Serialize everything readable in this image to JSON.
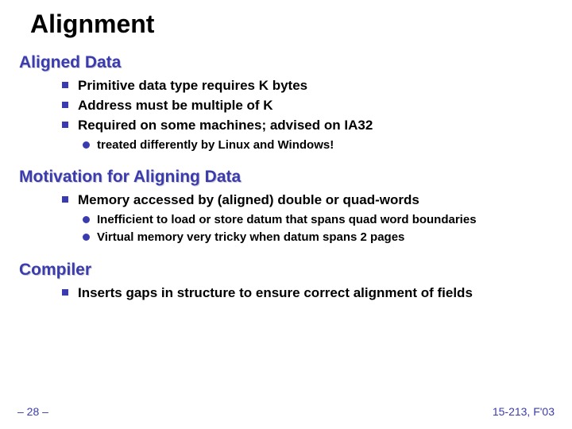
{
  "title": "Alignment",
  "sections": [
    {
      "heading": "Aligned Data",
      "items": [
        {
          "text": "Primitive data type requires K bytes"
        },
        {
          "text": "Address must be multiple of K"
        },
        {
          "text": "Required on some machines; advised on IA32",
          "subitems": [
            "treated differently by Linux and Windows!"
          ]
        }
      ]
    },
    {
      "heading": "Motivation for Aligning Data",
      "items": [
        {
          "text": "Memory accessed by (aligned) double or quad-words",
          "subitems": [
            "Inefficient to load or store datum that spans quad word boundaries",
            "Virtual memory very tricky when datum spans 2 pages"
          ]
        }
      ]
    },
    {
      "heading": "Compiler",
      "items": [
        {
          "text": "Inserts gaps in structure to ensure correct alignment of fields"
        }
      ]
    }
  ],
  "footer": {
    "page": "– 28 –",
    "course": "15-213, F'03"
  }
}
